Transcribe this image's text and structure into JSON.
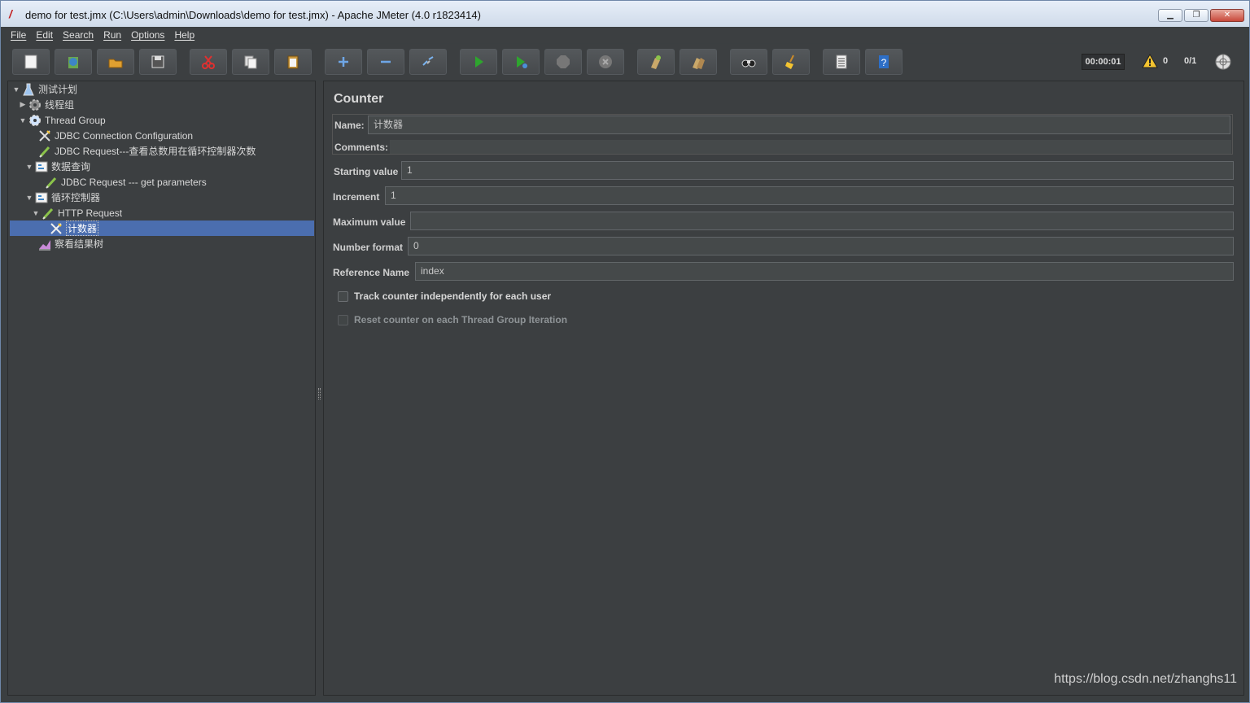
{
  "window": {
    "title": "demo for test.jmx (C:\\Users\\admin\\Downloads\\demo for test.jmx) - Apache JMeter (4.0 r1823414)",
    "app_icon": "/"
  },
  "menu": [
    "File",
    "Edit",
    "Search",
    "Run",
    "Options",
    "Help"
  ],
  "toolbar": {
    "icons": [
      "new-icon",
      "templates-icon",
      "open-icon",
      "save-icon",
      "cut-icon",
      "copy-icon",
      "paste-icon",
      "expand-icon",
      "collapse-icon",
      "toggle-icon",
      "start-icon",
      "start-no-pauses-icon",
      "stop-icon",
      "shutdown-icon",
      "clear-icon",
      "clear-all-icon",
      "search-icon",
      "reset-search-icon",
      "function-helper-icon",
      "help-icon"
    ],
    "timer": "00:00:01",
    "warnings": "0",
    "threads": "0/1"
  },
  "tree": [
    {
      "label": "测试计划",
      "icon": "test-plan-icon",
      "toggle": "▼"
    },
    {
      "label": "线程组",
      "icon": "gear-icon",
      "toggle": "▶"
    },
    {
      "label": "Thread Group",
      "icon": "gear-icon",
      "toggle": "▼"
    },
    {
      "label": "JDBC Connection Configuration",
      "icon": "wrench-icon",
      "toggle": ""
    },
    {
      "label": "JDBC Request---查看总数用在循环控制器次数",
      "icon": "sampler-icon",
      "toggle": ""
    },
    {
      "label": "数据查询",
      "icon": "controller-icon",
      "toggle": "▼"
    },
    {
      "label": "JDBC Request --- get parameters",
      "icon": "sampler-icon",
      "toggle": ""
    },
    {
      "label": "循环控制器",
      "icon": "controller-icon",
      "toggle": "▼"
    },
    {
      "label": "HTTP Request",
      "icon": "sampler-icon",
      "toggle": "▼"
    },
    {
      "label": "计数器",
      "icon": "wrench-icon",
      "toggle": ""
    },
    {
      "label": "察看结果树",
      "icon": "listener-icon",
      "toggle": ""
    }
  ],
  "panel": {
    "title": "Counter",
    "name_label": "Name:",
    "name_value": "计数器",
    "comments_label": "Comments:",
    "fields": [
      {
        "label": "Starting value",
        "value": "1"
      },
      {
        "label": "Increment",
        "value": "1"
      },
      {
        "label": "Maximum value",
        "value": ""
      },
      {
        "label": "Number format",
        "value": "0"
      },
      {
        "label": "Reference Name",
        "value": "index"
      }
    ],
    "checkboxes": [
      {
        "label": "Track counter independently for each user",
        "checked": false,
        "enabled": true
      },
      {
        "label": "Reset counter on each Thread Group Iteration",
        "checked": false,
        "enabled": false
      }
    ]
  },
  "watermark": "https://blog.csdn.net/zhanghs11"
}
